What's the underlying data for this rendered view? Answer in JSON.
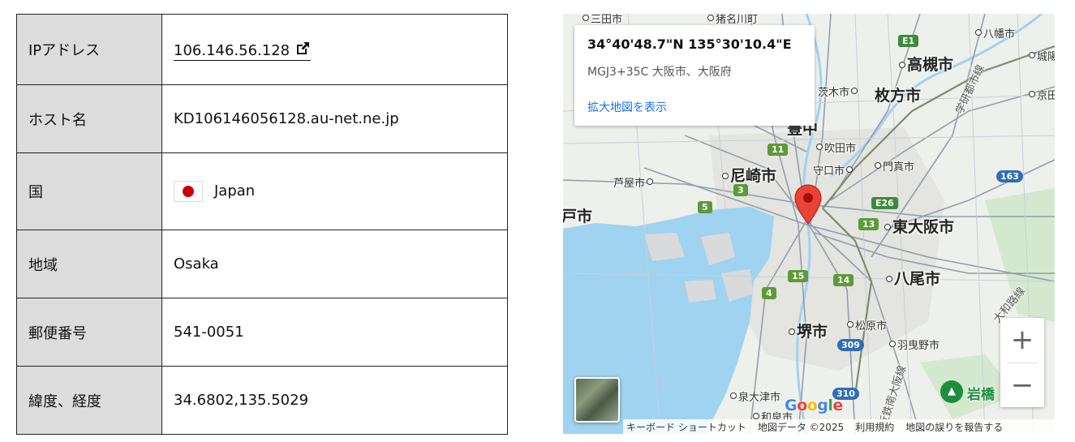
{
  "table": {
    "rows": [
      {
        "label": "IPアドレス",
        "value": "106.146.56.128"
      },
      {
        "label": "ホスト名",
        "value": "KD106146056128.au-net.ne.jp"
      },
      {
        "label": "国",
        "value": "Japan"
      },
      {
        "label": "地域",
        "value": "Osaka"
      },
      {
        "label": "郵便番号",
        "value": "541-0051"
      },
      {
        "label": "緯度、経度",
        "value": "34.6802,135.5029"
      }
    ]
  },
  "map": {
    "card": {
      "coords": "34°40'48.7\"N 135°30'10.4\"E",
      "address": "MGJ3+35C 大阪市、大阪府",
      "link": "拡大地図を表示"
    },
    "labels": {
      "takatsuki": "高槻市",
      "hirakata": "枚方市",
      "ibaraki": "茨木市",
      "yawata": "八幡市",
      "joyo": "城陽",
      "kyotanabe": "京田",
      "suita": "吹田市",
      "amagasaki": "尼崎市",
      "ashiya": "芦屋市",
      "moriguchi": "守口市",
      "kadoma": "門真市",
      "higashiosaka": "東大阪市",
      "yao": "八尾市",
      "sakai": "堺市",
      "matsubara": "松原市",
      "habikino": "羽曳野市",
      "izumiotsu": "泉大津市",
      "izumi": "和泉市",
      "kobe_fragment": "戸市",
      "toyonaka_fragment": "豊中",
      "mita": "三田市",
      "inagawa": "猪名川町",
      "katano_line": "学研都市線",
      "yamatoji_line": "大和路線",
      "kintetsu_line": "近鉄南大阪線"
    },
    "shields": {
      "e1": "E1",
      "r11": "11",
      "r3": "3",
      "r5": "5",
      "e26": "E26",
      "r13": "13",
      "r163": "163",
      "r15": "15",
      "r14": "14",
      "r4": "4",
      "r309": "309",
      "r310": "310"
    },
    "park": "岩橋",
    "zoom_in": "+",
    "zoom_out": "−",
    "google": "Google",
    "footer": {
      "shortcuts": "キーボード ショートカット",
      "mapdata": "地図データ ©2025",
      "terms": "利用規約",
      "report": "地図の誤りを報告する"
    },
    "colors": {
      "water": "#9fd3f0",
      "park": "#c8e6c9",
      "pin": "#ea4335",
      "link": "#1a73e8"
    }
  }
}
